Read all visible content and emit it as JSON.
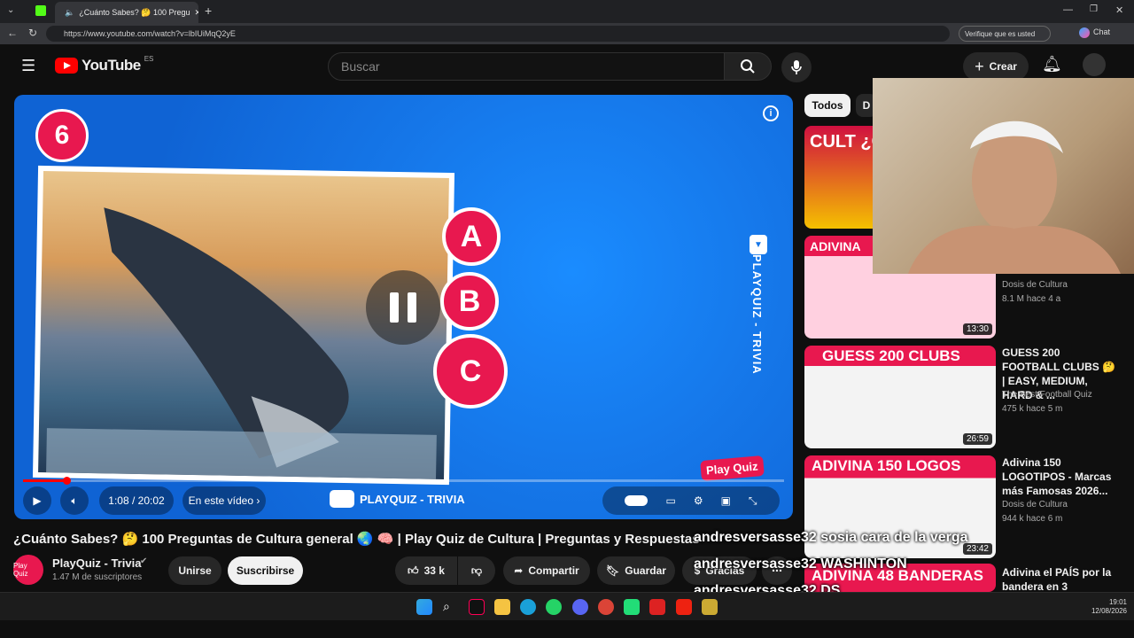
{
  "browser": {
    "tab_title": "¿Cuánto Sabes? 🤔 100 Pregu",
    "url": "https://www.youtube.com/watch?v=lbIUiMqQ2yE",
    "verify_label": "Verifique que es usted",
    "chat_label": "Chat"
  },
  "header": {
    "logo": "YouTube",
    "region": "ES",
    "search_placeholder": "Buscar",
    "create_label": "Crear"
  },
  "video": {
    "question_number": "6",
    "options": [
      "A",
      "B",
      "C"
    ],
    "side_text": "PLAYQUIZ - TRIVIA",
    "time": "1:08 / 20:02",
    "chapter": "En este vídeo",
    "channel_banner": "PLAYQUIZ - TRIVIA",
    "progress": 0.057,
    "title": "¿Cuánto Sabes? 🤔 100 Preguntas de Cultura general 🌏 🧠 | Play Quiz de Cultura | Preguntas y Respuestas",
    "watermark": "Play Quiz"
  },
  "channel": {
    "name": "PlayQuiz - Trivia",
    "subs": "1.47 M de suscriptores",
    "avatar": "Play Quiz",
    "join": "Unirse",
    "subscribe": "Suscribirse"
  },
  "actions": {
    "likes": "33 k",
    "share": "Compartir",
    "save": "Guardar",
    "thanks": "Gracias"
  },
  "sidebar": {
    "chip_all": "Todos",
    "chip_next": "D",
    "items": [
      {
        "thumb_text": "CULT ¿CUÁ ARG 48",
        "title": "",
        "channel": "",
        "meta": "",
        "duration": ""
      },
      {
        "thumb_text": "ADIVINA",
        "title": "",
        "channel": "Dosis de Cultura",
        "meta": "8.1 M  hace 4 a",
        "duration": "13:30"
      },
      {
        "thumb_text": "GUESS 200 CLUBS",
        "title": "GUESS 200 FOOTBALL CLUBS 🤔 | EASY, MEDIUM, HARD & ...",
        "channel": "The Best Football Quiz",
        "meta": "475 k  hace 5 m",
        "duration": "26:59"
      },
      {
        "thumb_text": "ADIVINA 150 LOGOS",
        "title": "Adivina 150 LOGOTIPOS - Marcas más Famosas 2026...",
        "channel": "Dosis de Cultura",
        "meta": "944 k  hace 6 m",
        "duration": "23:42"
      },
      {
        "thumb_text": "ADIVINA 48 BANDERAS",
        "title": "Adivina el PAÍS por la bandera en 3",
        "channel": "",
        "meta": "",
        "duration": ""
      }
    ]
  },
  "chat_overlay": [
    "andresversasse32  sosia cara de la verga",
    "andresversasse32  WASHINTON",
    "andresversasse32  DS"
  ],
  "taskbar": {
    "time": "19:01",
    "date": "12/08/2026"
  }
}
